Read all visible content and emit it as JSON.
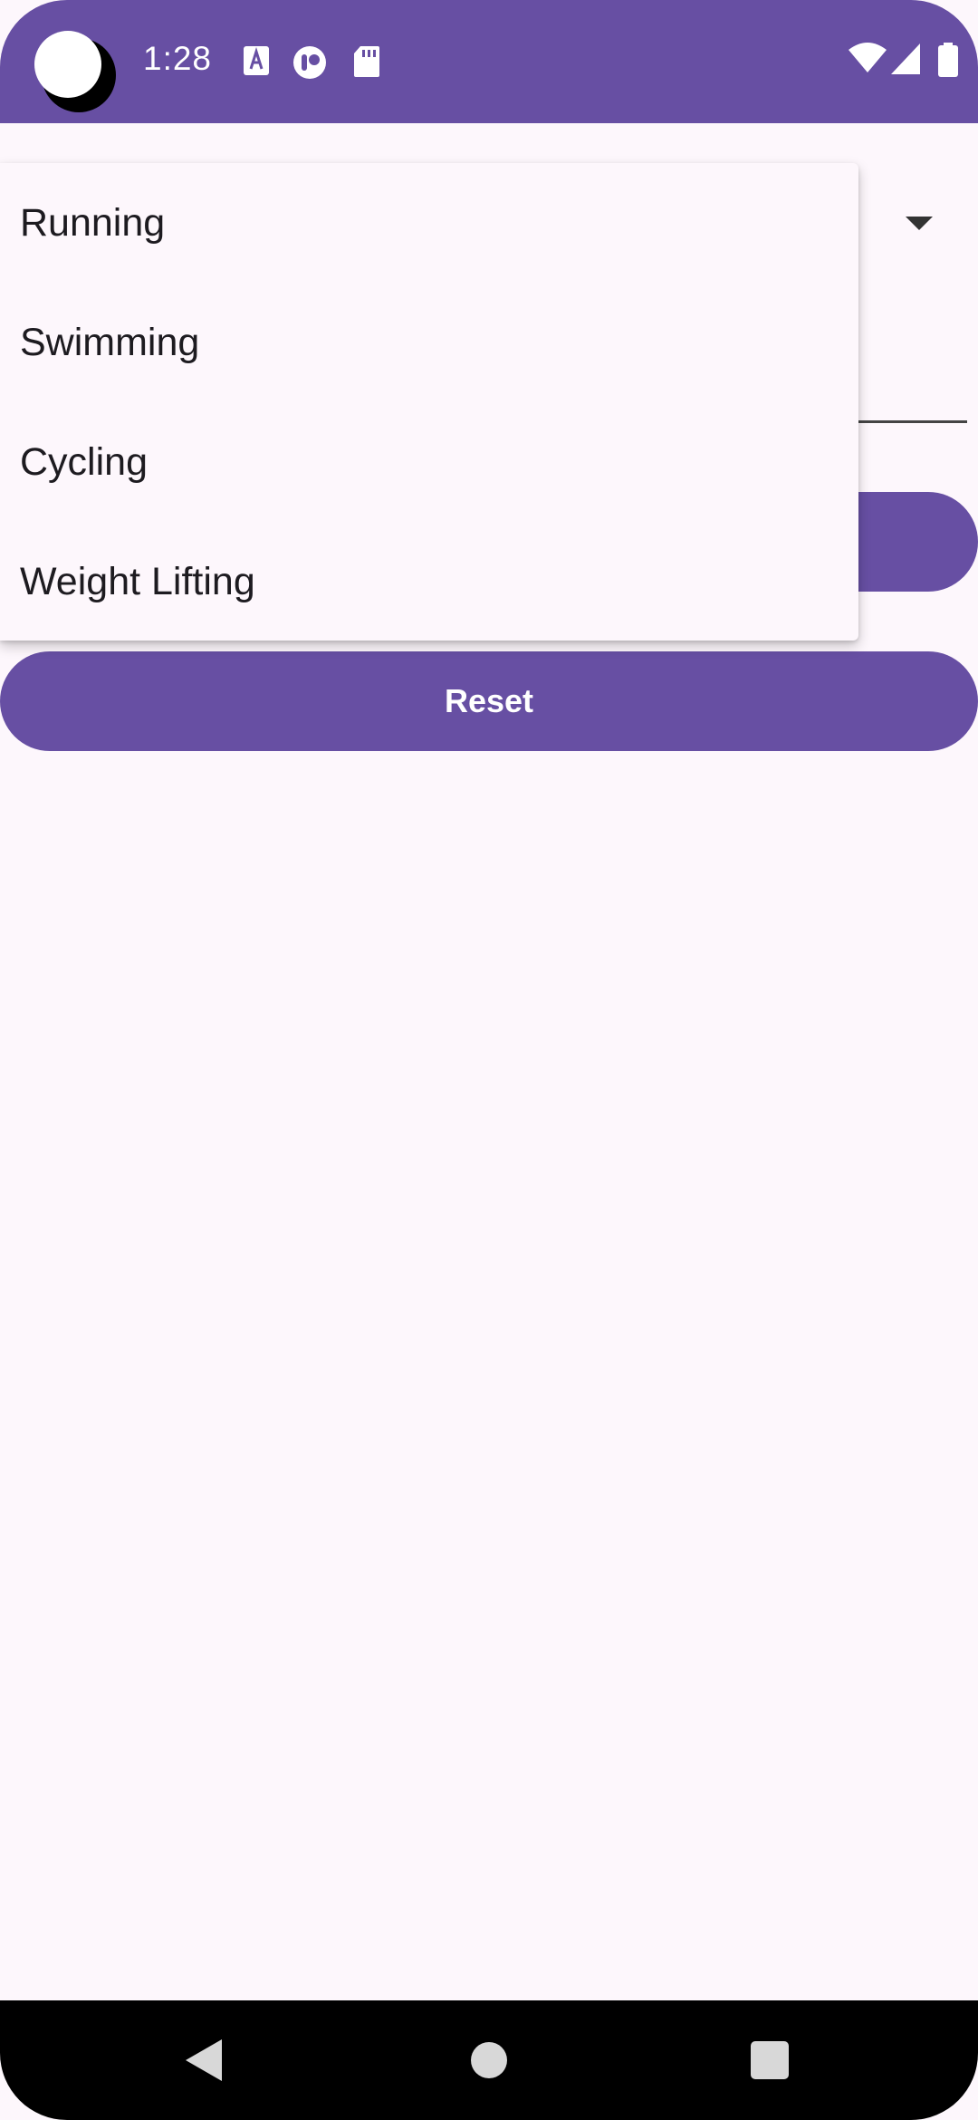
{
  "status_bar": {
    "time": "1:28",
    "notification_icons": [
      "font-a-icon",
      "tumblr-like-app-icon",
      "sd-card-icon"
    ],
    "system_icons": [
      "wifi-icon",
      "cell-signal-icon",
      "battery-icon"
    ]
  },
  "dropdown_menu": {
    "items": [
      "Running",
      "Swimming",
      "Cycling",
      "Weight Lifting"
    ]
  },
  "buttons": {
    "reset_label": "Reset"
  },
  "colors": {
    "primary": "#674fa3",
    "background": "#fdf7fc",
    "text": "#1d1b20"
  }
}
